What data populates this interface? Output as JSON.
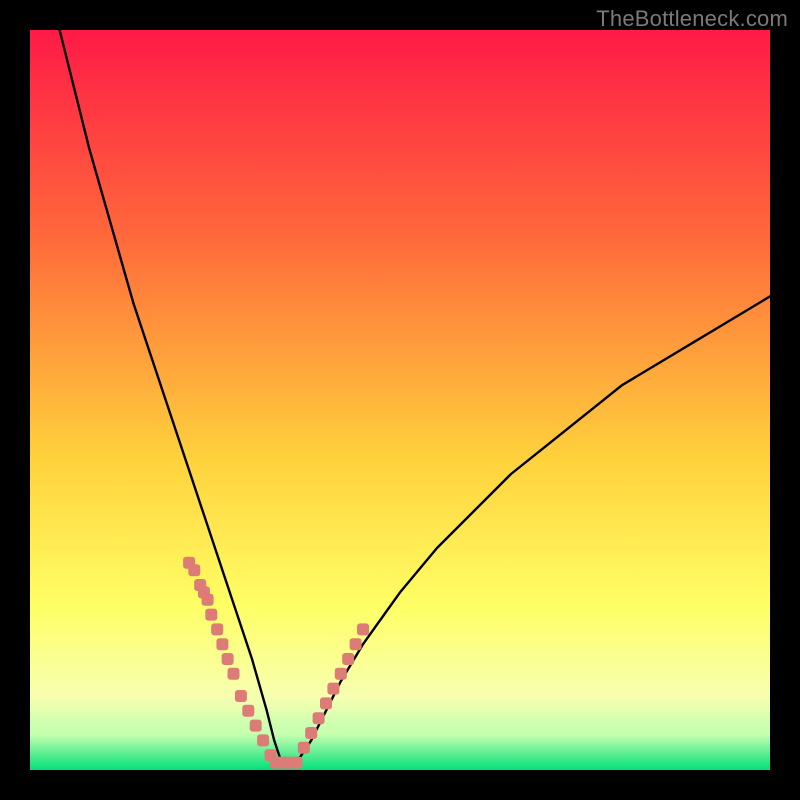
{
  "watermark": "TheBottleneck.com",
  "colors": {
    "frame": "#000000",
    "curve": "#000000",
    "dots": "#dd7b77",
    "grad_top": "#ff1a47",
    "grad_mid1": "#ff693b",
    "grad_mid2": "#ffd23c",
    "grad_mid3": "#ffff66",
    "grad_low1": "#f7ffb0",
    "grad_low2": "#c9ffb0",
    "grad_bottom": "#00e07a"
  },
  "chart_data": {
    "type": "line",
    "title": "",
    "xlabel": "",
    "ylabel": "",
    "xlim": [
      0,
      100
    ],
    "ylim": [
      0,
      100
    ],
    "grid": false,
    "legend": false,
    "series": [
      {
        "name": "bottleneck-curve",
        "x": [
          4,
          6,
          8,
          10,
          12,
          14,
          16,
          18,
          20,
          22,
          24,
          26,
          28,
          30,
          32,
          33,
          34,
          35,
          36,
          38,
          40,
          42,
          45,
          50,
          55,
          60,
          65,
          70,
          75,
          80,
          85,
          90,
          95,
          100
        ],
        "values": [
          100,
          92,
          84,
          77,
          70,
          63,
          57,
          51,
          45,
          39,
          33,
          27,
          21,
          15,
          8,
          4,
          1,
          1,
          1,
          4,
          8,
          12,
          17,
          24,
          30,
          35,
          40,
          44,
          48,
          52,
          55,
          58,
          61,
          64
        ]
      }
    ],
    "highlight_points": {
      "name": "curve-dots",
      "x": [
        21.5,
        22.2,
        23.0,
        23.5,
        24.0,
        24.5,
        25.3,
        26.0,
        26.7,
        27.5,
        28.5,
        29.5,
        30.5,
        31.5,
        32.5,
        33.2,
        34.0,
        35.0,
        36.0,
        37.0,
        38.0,
        39.0,
        40.0,
        41.0,
        42.0,
        43.0,
        44.0,
        45.0
      ],
      "values": [
        28,
        27,
        25,
        24,
        23,
        21,
        19,
        17,
        15,
        13,
        10,
        8,
        6,
        4,
        2,
        1,
        1,
        1,
        1,
        3,
        5,
        7,
        9,
        11,
        13,
        15,
        17,
        19
      ]
    }
  }
}
